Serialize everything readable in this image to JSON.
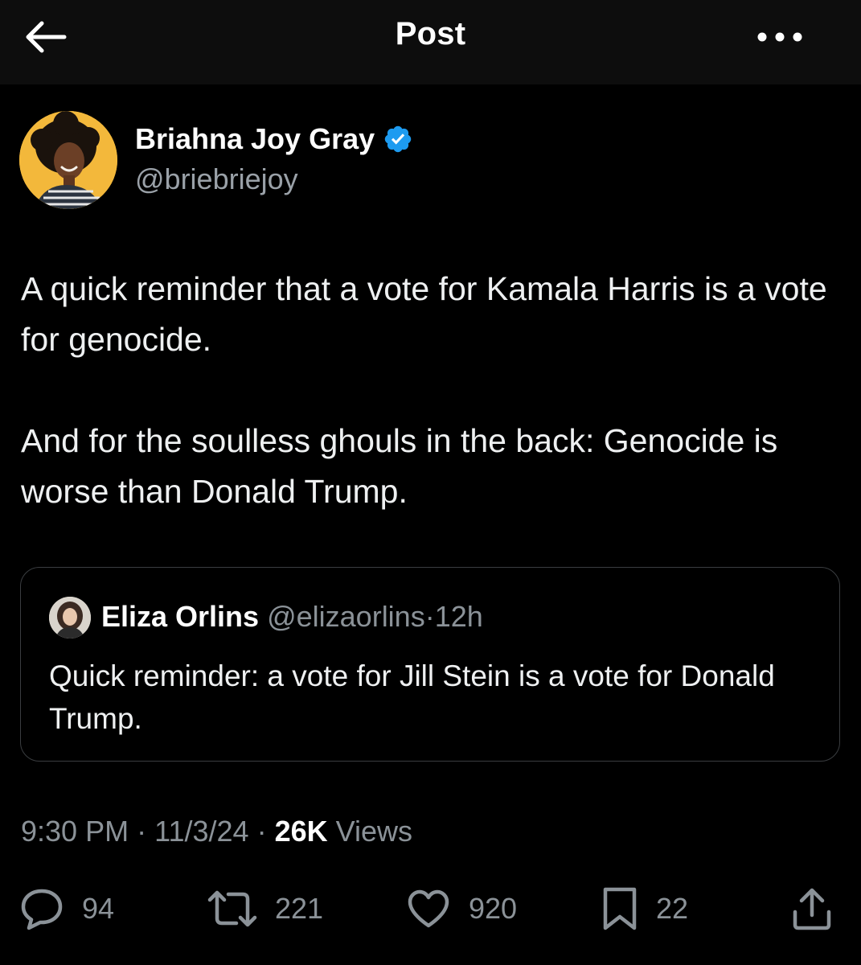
{
  "header": {
    "title": "Post",
    "back_icon": "arrow-left-icon",
    "more_icon": "more-dots-icon"
  },
  "author": {
    "name": "Briahna Joy Gray",
    "handle": "@briebriejoy",
    "verified_icon": "verified-badge-icon",
    "verified_color": "#1d9bf0"
  },
  "tweet": {
    "paragraphs": [
      "A quick reminder that a vote for Kamala Harris is a vote for genocide.",
      "And for the soulless ghouls in the back: Genocide is worse than Donald Trump."
    ]
  },
  "quote": {
    "name": "Eliza Orlins",
    "handle": "@elizaorlins",
    "separator": "·",
    "time": "12h",
    "text": "Quick reminder: a vote for Jill Stein is a vote for Donald Trump."
  },
  "meta": {
    "time": "9:30 PM",
    "separator": "·",
    "date": "11/3/24",
    "views_count": "26K",
    "views_label": "Views"
  },
  "actions": {
    "replies": "94",
    "reposts": "221",
    "likes": "920",
    "bookmarks": "22",
    "reply_icon": "reply-bubble-icon",
    "repost_icon": "repost-icon",
    "like_icon": "heart-icon",
    "bookmark_icon": "bookmark-icon",
    "share_icon": "share-icon"
  },
  "colors": {
    "background": "#000000",
    "header_background": "#0d0d0d",
    "text_primary": "#e7e9ea",
    "text_secondary": "#8b9298",
    "border": "#3a3d40",
    "avatar_background": "#f3b83b"
  }
}
